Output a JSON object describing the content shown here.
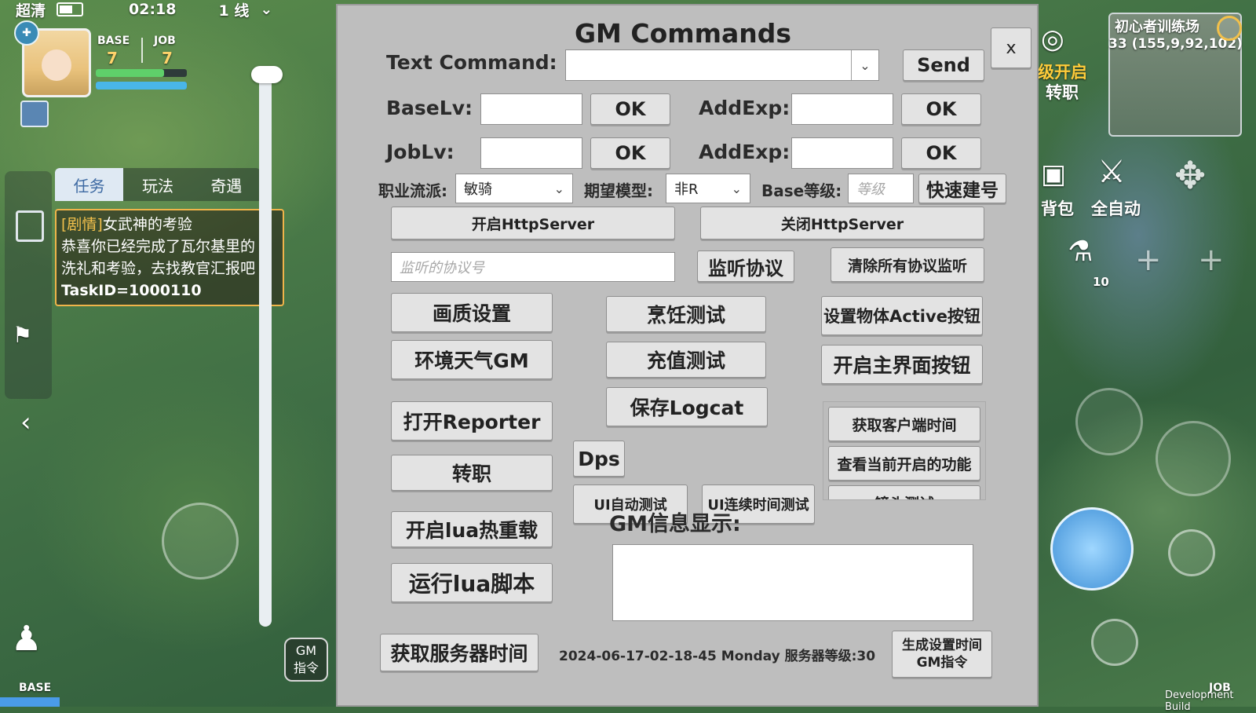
{
  "status": {
    "quality": "超清",
    "time": "02:18",
    "line": "1 线"
  },
  "player": {
    "base_label": "BASE",
    "job_label": "JOB",
    "base_level": "7",
    "job_level": "7",
    "hp_fill": 0.75,
    "mp_fill": 1.0
  },
  "left_panel": {
    "tabs": [
      {
        "label": "任务"
      },
      {
        "label": "玩法"
      },
      {
        "label": "奇遇"
      }
    ],
    "quest": {
      "tag": "[剧情]",
      "title": "女武神的考验",
      "line1": "恭喜你已经完成了瓦尔基里的",
      "line2": "洗礼和考验，去找教官汇报吧",
      "task_id": "TaskID=1000110"
    }
  },
  "bottom_left": {
    "base_label": "BASE"
  },
  "gm_entry": {
    "line1": "GM",
    "line2": "指令"
  },
  "right_hud": {
    "map_title": "初心者训练场",
    "map_coord": "33 (155,9,92,102)",
    "job_change_line1": "级开启",
    "job_change_line2": "转职",
    "bag": "背包",
    "auto": "全自动",
    "potion_count": "10",
    "dev_build": "Development Build",
    "job_label": "JOB"
  },
  "gm": {
    "title": "GM Commands",
    "close": "x",
    "text_command_label": "Text Command:",
    "text_command_value": "",
    "send": "Send",
    "base_lv_label": "BaseLv:",
    "job_lv_label": "JobLv:",
    "add_exp_label": "AddExp:",
    "ok": "OK",
    "career_label": "职业流派:",
    "career_value": "敏骑",
    "model_label": "期望模型:",
    "model_value": "非R",
    "base_level_label": "Base等级:",
    "base_level_placeholder": "等级",
    "quick_create": "快速建号",
    "open_http": "开启HttpServer",
    "close_http": "关闭HttpServer",
    "protocol_placeholder": "监听的协议号",
    "listen_protocol": "监听协议",
    "clear_listeners": "清除所有协议监听",
    "buttons": {
      "quality_settings": "画质设置",
      "env_weather": "环境天气GM",
      "open_reporter": "打开Reporter",
      "job_change": "转职",
      "lua_hot_reload": "开启lua热重载",
      "run_lua": "运行lua脚本",
      "cooking_test": "烹饪测试",
      "recharge_test": "充值测试",
      "save_logcat": "保存Logcat",
      "dps": "Dps",
      "ui_auto_test": "UI自动测试",
      "ui_continuous_test": "UI连续时间测试",
      "set_active": "设置物体Active按钮",
      "open_main_buttons": "开启主界面按钮",
      "get_client_time": "获取客户端时间",
      "view_enabled_features": "查看当前开启的功能",
      "lens_test": "镜头测试",
      "get_server_time": "获取服务器时间",
      "gen_time_gm_line1": "生成设置时间",
      "gen_time_gm_line2": "GM指令"
    },
    "info_label": "GM信息显示:",
    "info_text": "",
    "server_info": "2024-06-17-02-18-45 Monday 服务器等级:30"
  }
}
